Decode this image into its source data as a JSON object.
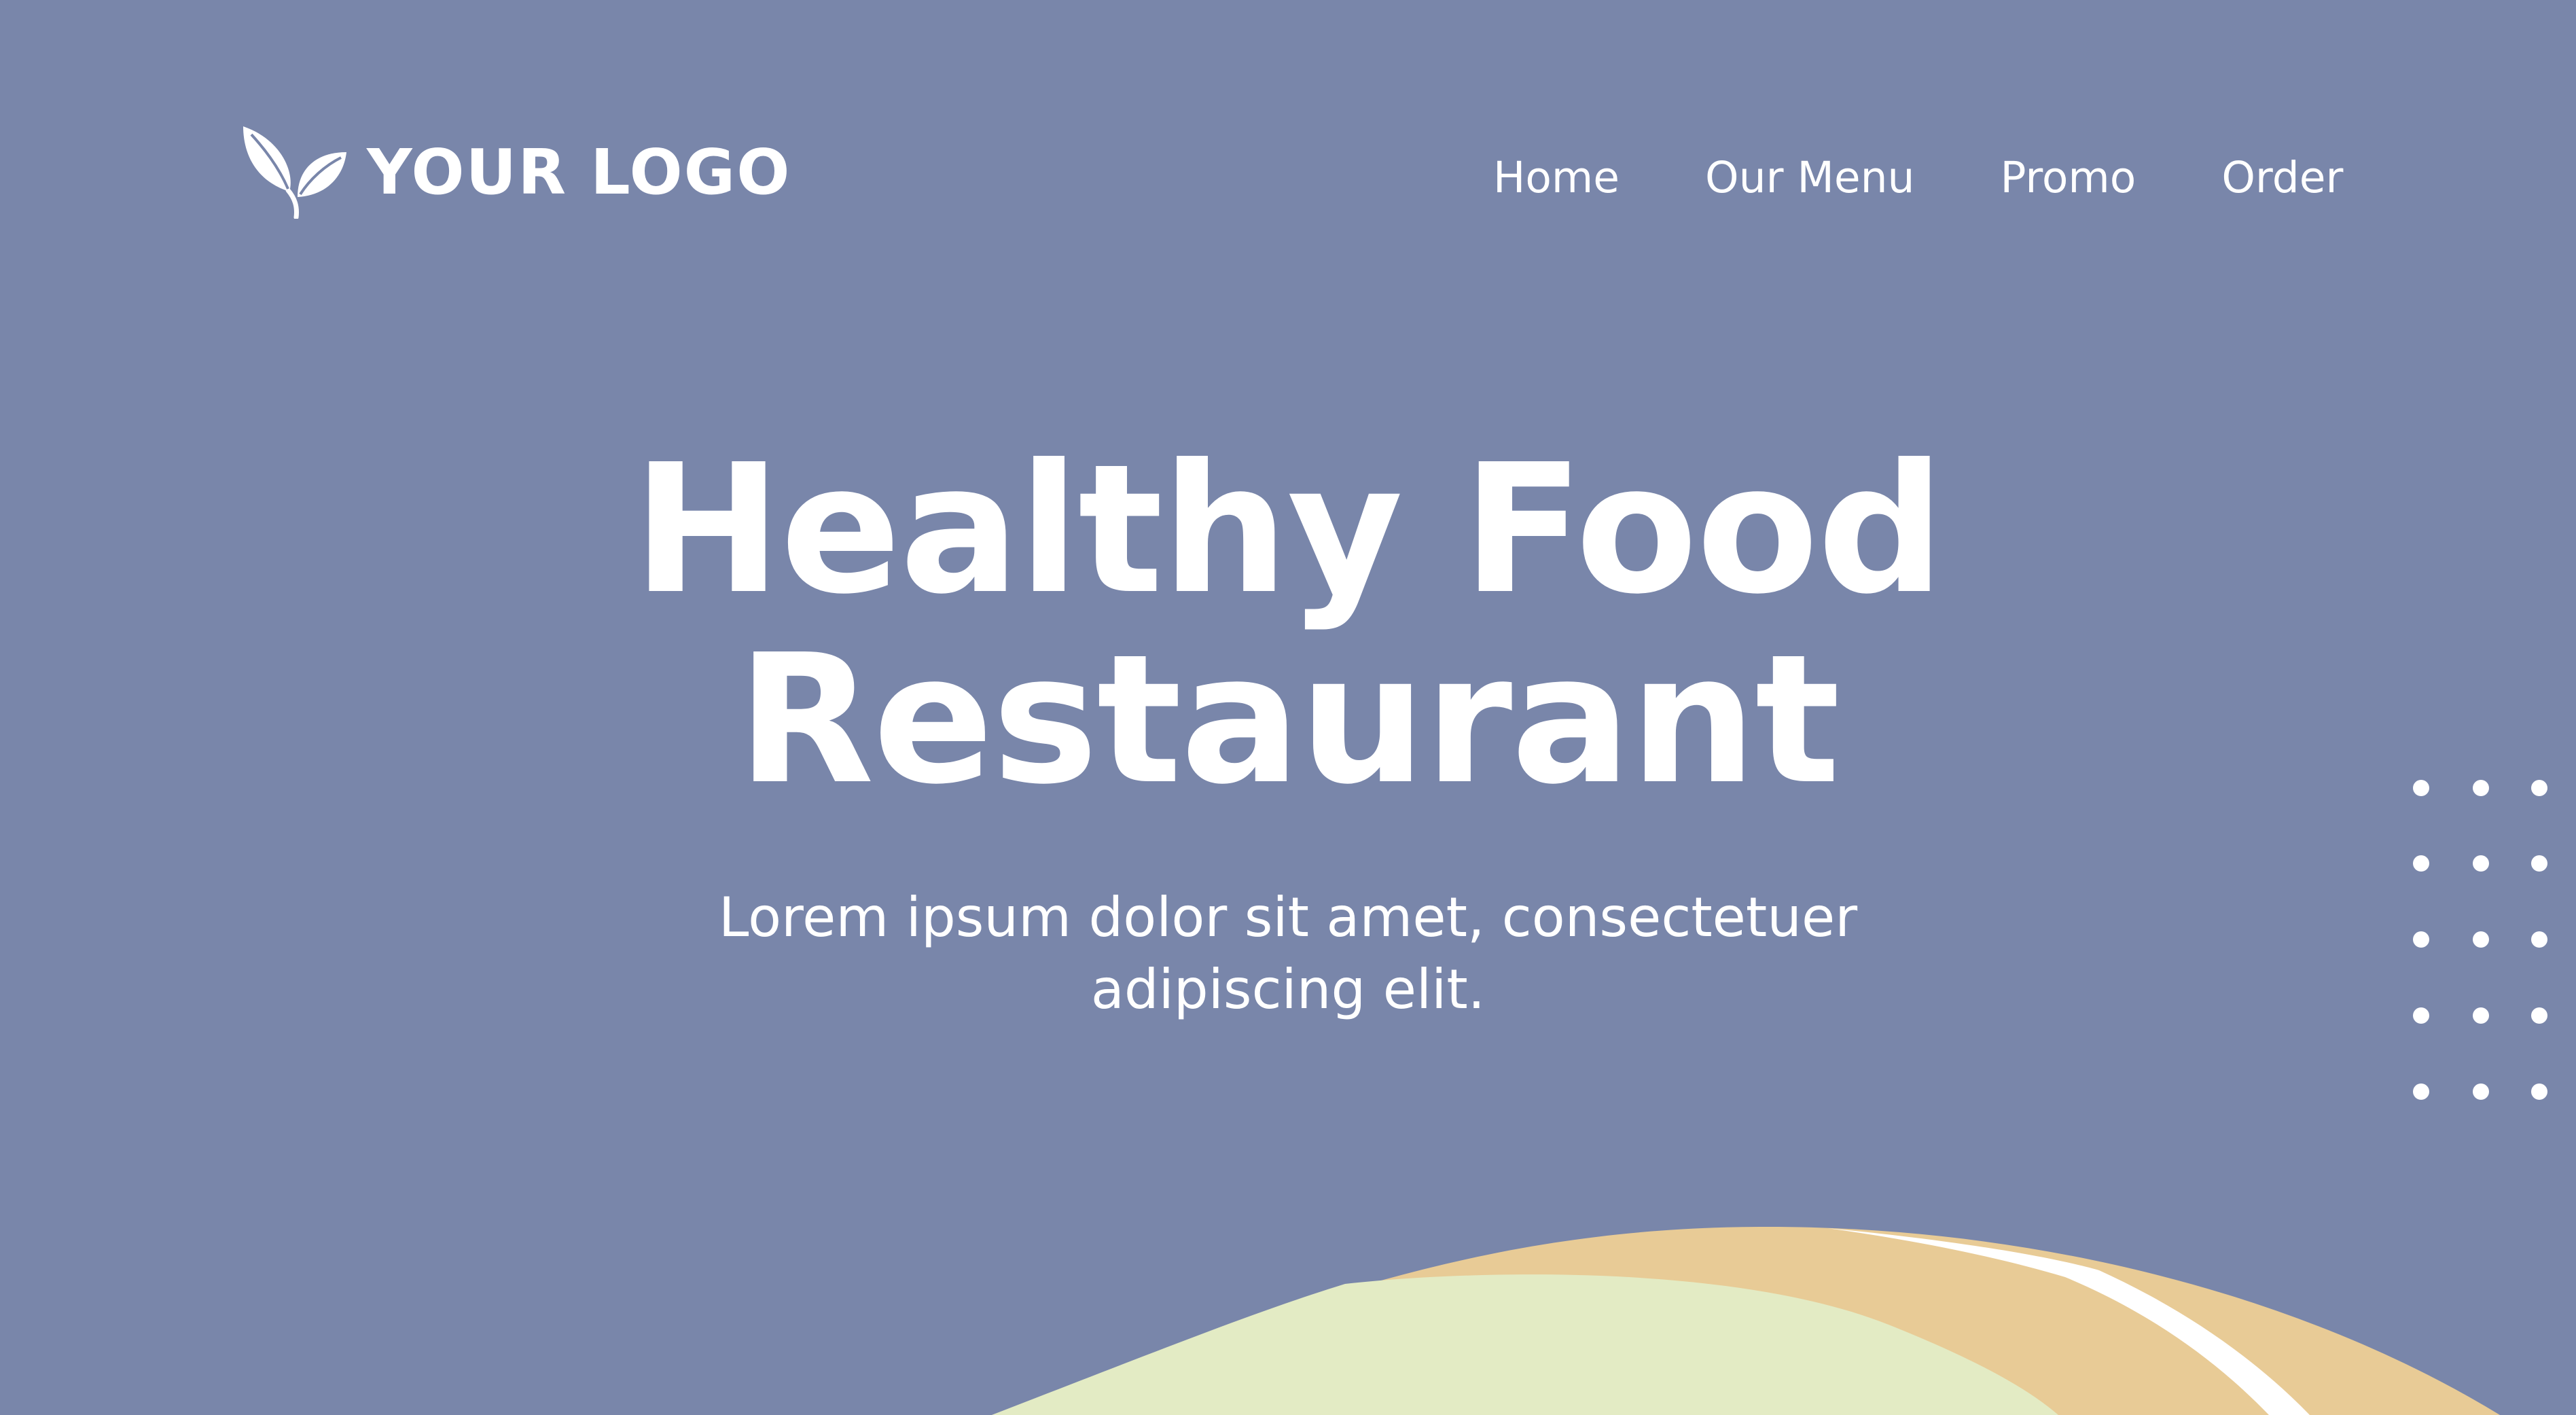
{
  "colors": {
    "background": "#7986aa",
    "foreground": "#ffffff",
    "bowl_rim": "#e8cb96",
    "bowl_inner": "#e3ebc4"
  },
  "header": {
    "logo_icon": "leaf-sprout-icon",
    "logo_text": "YOUR LOGO",
    "nav": [
      {
        "label": "Home"
      },
      {
        "label": "Our Menu"
      },
      {
        "label": "Promo"
      },
      {
        "label": "Order"
      }
    ]
  },
  "hero": {
    "title_line_1": "Healthy Food",
    "title_line_2": "Restaurant",
    "subtitle": "Lorem ipsum dolor sit amet, consectetuer adipiscing elit."
  },
  "decorations": {
    "dot_grid_icon": "dot-grid-pattern",
    "bowl_icon": "food-bowl-illustration"
  }
}
